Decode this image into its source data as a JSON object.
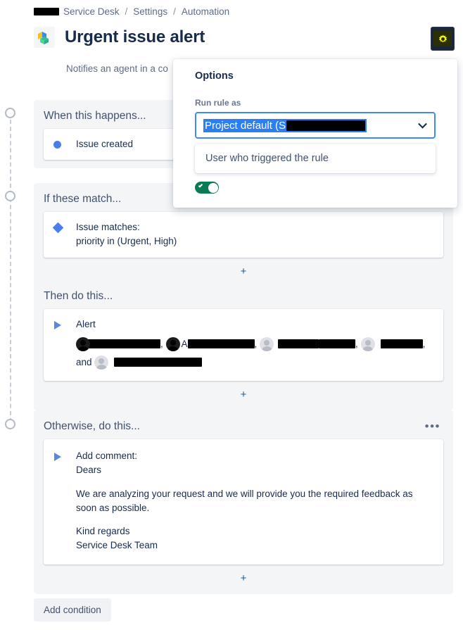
{
  "breadcrumb": {
    "redacted_prefix": true,
    "items": [
      {
        "label": "Service Desk"
      },
      {
        "label": "Settings"
      },
      {
        "label": "Automation"
      }
    ],
    "separator": "/"
  },
  "header": {
    "title": "Urgent issue alert",
    "icon": "blocks-cube-icon",
    "description": "Notifies an agent in a co",
    "settings_button_icon": "gear-icon",
    "settings_accent_color": "#f5f500",
    "settings_bg_color": "#1b2638"
  },
  "sections": [
    {
      "id": "when",
      "title": "When this happens...",
      "has_menu": false,
      "cards": [
        {
          "icon": "circle-trigger-icon",
          "icon_type": "dot",
          "line1": "Issue created",
          "line2": ""
        }
      ],
      "show_plus": false
    },
    {
      "id": "if",
      "title": "If these match...",
      "has_menu": false,
      "cards": [
        {
          "icon": "diamond-condition-icon",
          "icon_type": "diamond",
          "line1": "Issue matches:",
          "line2": "priority in (Urgent, High)"
        }
      ],
      "show_plus": true,
      "plus_label": "+"
    },
    {
      "id": "then",
      "title": "Then do this...",
      "has_menu": false,
      "cards": [
        {
          "icon": "triangle-action-icon",
          "icon_type": "triangle",
          "line1": "Alert",
          "line2": "redacted-recipients"
        }
      ],
      "show_plus": true,
      "plus_label": "+"
    },
    {
      "id": "otherwise",
      "title": "Otherwise, do this...",
      "has_menu": true,
      "menu_icon": "more-options-icon",
      "menu_label": "•••",
      "cards": [
        {
          "icon": "triangle-action-icon",
          "icon_type": "triangle",
          "line1": "Add comment:",
          "comment": {
            "greeting": "Dears",
            "body": "We are analyzing your request and we will provide you the required feedback as soon as possible.",
            "signoff": "Kind regards",
            "signature": "Service Desk Team"
          }
        }
      ],
      "show_plus": true,
      "plus_label": "+"
    }
  ],
  "alert_recipients": {
    "conjunction": ", and ",
    "visible_fragment": "A",
    "comma": ", "
  },
  "footer": {
    "add_condition_label": "Add condition"
  },
  "options_popup": {
    "title": "Options",
    "run_rule_as": {
      "label": "Run rule as",
      "selected_value": "Project default (S",
      "value_redacted": true,
      "chevron_icon": "chevron-down-icon",
      "options": [
        {
          "label": "User who triggered the rule"
        }
      ]
    },
    "toggle": {
      "state": "on",
      "icon": "check-icon",
      "color": "#0a7a55"
    }
  },
  "timeline": {
    "dot_count": 3,
    "style": "dashed"
  }
}
